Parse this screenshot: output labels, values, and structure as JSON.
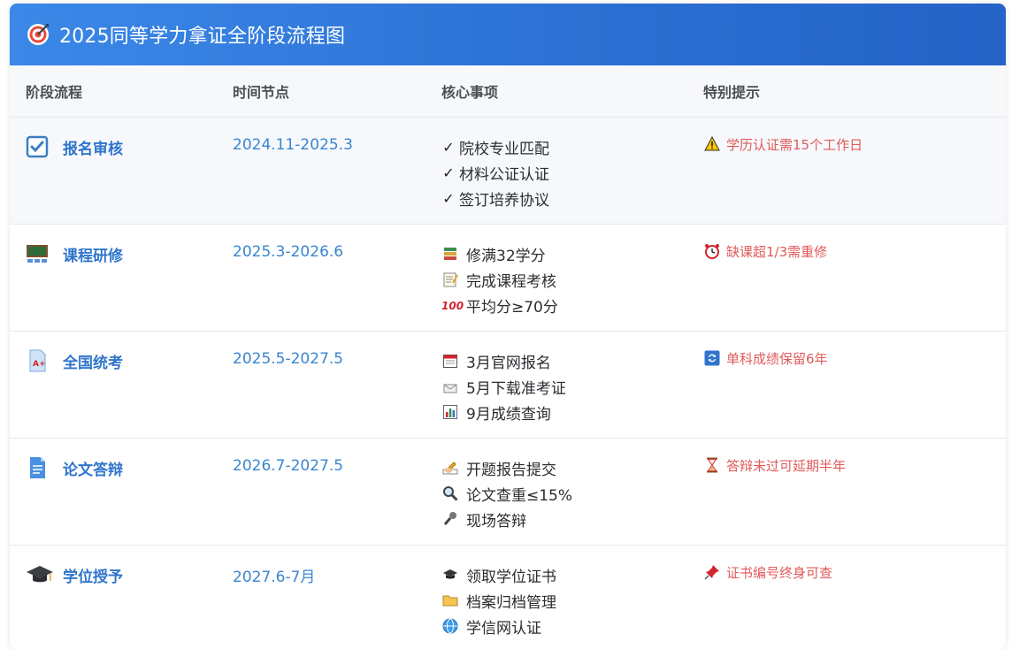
{
  "header": {
    "title": "2025同等学力拿证全阶段流程图",
    "icon": "target-icon"
  },
  "columns": [
    "阶段流程",
    "时间节点",
    "核心事项",
    "特别提示"
  ],
  "rows": [
    {
      "stage": "报名审核",
      "stage_icon": "checkbox-icon",
      "time": "2024.11-2025.3",
      "items": [
        {
          "icon": "check-mark",
          "text": "院校专业匹配"
        },
        {
          "icon": "check-mark",
          "text": "材料公证认证"
        },
        {
          "icon": "check-mark",
          "text": "签订培养协议"
        }
      ],
      "tip": {
        "icon": "warning-icon",
        "text": "学历认证需15个工作日"
      }
    },
    {
      "stage": "课程研修",
      "stage_icon": "classroom-icon",
      "time": "2025.3-2026.6",
      "items": [
        {
          "icon": "books-icon",
          "text": "修满32学分"
        },
        {
          "icon": "memo-icon",
          "text": "完成课程考核"
        },
        {
          "icon": "hundred-points-icon",
          "text": "平均分≥70分"
        }
      ],
      "tip": {
        "icon": "alarm-clock-icon",
        "text": "缺课超1/3需重修"
      }
    },
    {
      "stage": "全国统考",
      "stage_icon": "exam-paper-icon",
      "time": "2025.5-2027.5",
      "items": [
        {
          "icon": "calendar-icon",
          "text": "3月官网报名"
        },
        {
          "icon": "envelope-icon",
          "text": "5月下载准考证"
        },
        {
          "icon": "bar-chart-icon",
          "text": "9月成绩查询"
        }
      ],
      "tip": {
        "icon": "repeat-icon",
        "text": "单科成绩保留6年"
      }
    },
    {
      "stage": "论文答辩",
      "stage_icon": "document-icon",
      "time": "2026.7-2027.5",
      "items": [
        {
          "icon": "writing-hand-icon",
          "text": "开题报告提交"
        },
        {
          "icon": "magnifier-icon",
          "text": "论文查重≤15%"
        },
        {
          "icon": "microphone-icon",
          "text": "现场答辩"
        }
      ],
      "tip": {
        "icon": "hourglass-icon",
        "text": "答辩未过可延期半年"
      }
    },
    {
      "stage": "学位授予",
      "stage_icon": "graduation-cap-icon",
      "time": "2027.6-7月",
      "items": [
        {
          "icon": "graduation-cap-icon",
          "text": "领取学位证书"
        },
        {
          "icon": "folder-icon",
          "text": "档案归档管理"
        },
        {
          "icon": "globe-icon",
          "text": "学信网认证"
        }
      ],
      "tip": {
        "icon": "pushpin-icon",
        "text": "证书编号终身可查"
      }
    }
  ],
  "colors": {
    "header_start": "#3b88e8",
    "header_end": "#2463c7",
    "stage_text": "#2f75cc",
    "time_text": "#3a86cf",
    "tip_text": "#e05a5a"
  }
}
